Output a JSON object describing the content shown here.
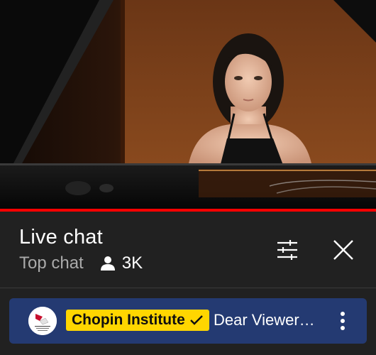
{
  "live_chat": {
    "title": "Live chat",
    "mode_label": "Top chat",
    "viewer_count": "3K",
    "filter_icon": "tune-icon",
    "close_icon": "close-icon"
  },
  "video": {
    "progress_fraction": 1.0
  },
  "pinned_message": {
    "author": "Chopin Institute",
    "verified_icon": "checkmark-icon",
    "text": "Dear Viewer…",
    "menu_icon": "more-vert-icon"
  },
  "colors": {
    "accent": "#ff0000",
    "panel_background": "#212121",
    "pinned_background": "#243a72",
    "author_chip": "#ffd600"
  }
}
